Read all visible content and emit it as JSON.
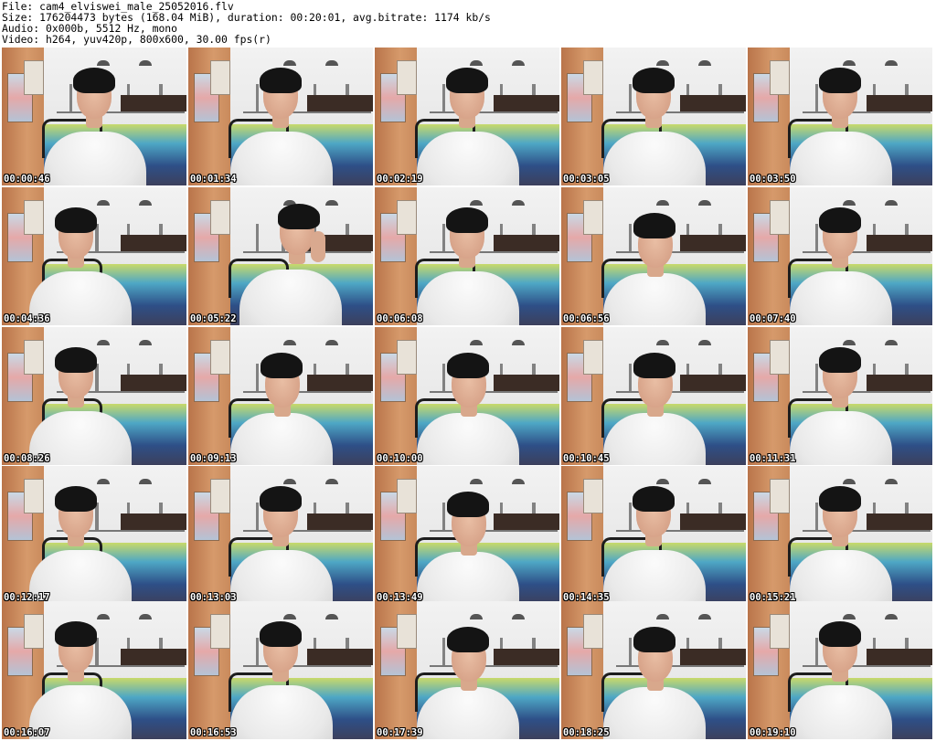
{
  "header": {
    "file": "File: cam4_elviswei_male_25052016.flv",
    "size": "Size: 176204473 bytes (168.04 MiB), duration: 00:20:01, avg.bitrate: 1174 kb/s",
    "audio": "Audio: 0x000b, 5512 Hz, mono",
    "video": "Video: h264, yuv420p, 800x600, 30.00 fps(r)"
  },
  "thumbnails": [
    {
      "time": "00:00:46",
      "pose": "front"
    },
    {
      "time": "00:01:34",
      "pose": "front"
    },
    {
      "time": "00:02:19",
      "pose": "front"
    },
    {
      "time": "00:03:05",
      "pose": "front"
    },
    {
      "time": "00:03:50",
      "pose": "front"
    },
    {
      "time": "00:04:36",
      "pose": "left"
    },
    {
      "time": "00:05:22",
      "pose": "hand"
    },
    {
      "time": "00:06:08",
      "pose": "front"
    },
    {
      "time": "00:06:56",
      "pose": "down"
    },
    {
      "time": "00:07:40",
      "pose": "front"
    },
    {
      "time": "00:08:26",
      "pose": "left"
    },
    {
      "time": "00:09:13",
      "pose": "down"
    },
    {
      "time": "00:10:00",
      "pose": "down"
    },
    {
      "time": "00:10:45",
      "pose": "down"
    },
    {
      "time": "00:11:31",
      "pose": "front"
    },
    {
      "time": "00:12:17",
      "pose": "left"
    },
    {
      "time": "00:13:03",
      "pose": "front"
    },
    {
      "time": "00:13:49",
      "pose": "down"
    },
    {
      "time": "00:14:35",
      "pose": "front"
    },
    {
      "time": "00:15:21",
      "pose": "front"
    },
    {
      "time": "00:16:07",
      "pose": "left"
    },
    {
      "time": "00:16:53",
      "pose": "front"
    },
    {
      "time": "00:17:39",
      "pose": "down"
    },
    {
      "time": "00:18:25",
      "pose": "down"
    },
    {
      "time": "00:19:10",
      "pose": "front"
    }
  ],
  "colors": {
    "background": "#ffffff",
    "header_text": "#000000",
    "timestamp_text": "#ffffff",
    "timestamp_outline": "#000000",
    "shirt": "#ebebeb",
    "hair": "#141414",
    "door": "#c98a5c",
    "bedding": "#2e4f87"
  }
}
